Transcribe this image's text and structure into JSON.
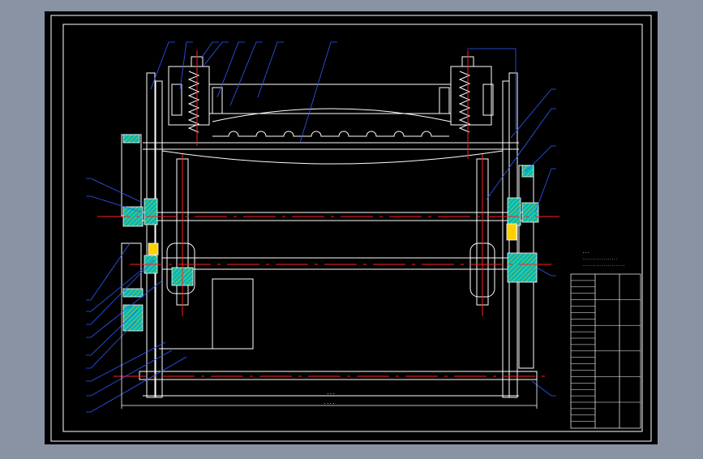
{
  "drawing": {
    "background": "#000000",
    "frame_color": "#ffffff",
    "line_color": "#ffffff",
    "center_line_color": "#ff2020",
    "leader_color": "#2e5bff",
    "section_fill": "#00b8b8",
    "hatch_color": "#ffd000",
    "dimension_color": "#ffffff"
  },
  "dimensions": {
    "inner": "...",
    "outer": "...."
  },
  "title_block": {
    "notes_heading": "...",
    "notes_line1": "..................",
    "notes_line2": "......................"
  }
}
